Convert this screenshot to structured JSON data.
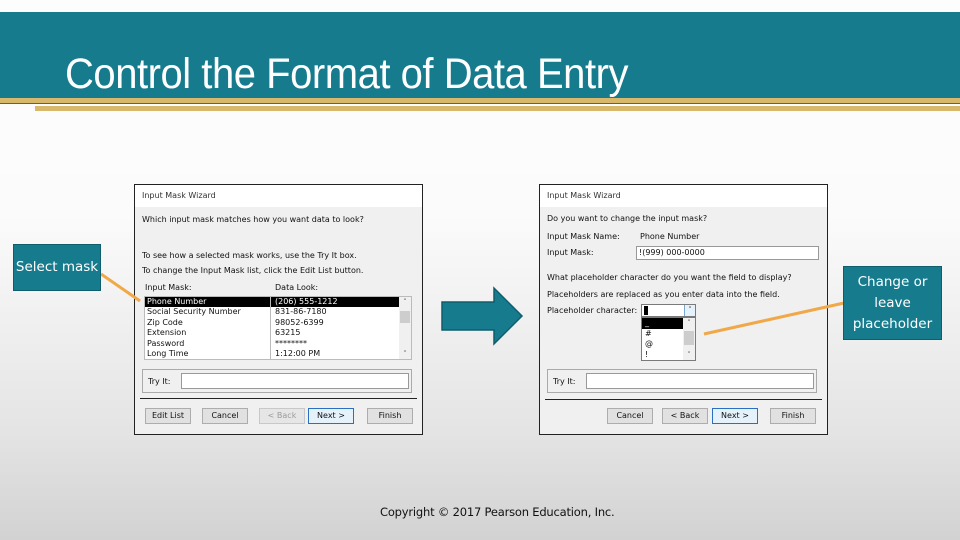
{
  "slide": {
    "title": "Control the Format of Data Entry",
    "footer": "Copyright © 2017 Pearson Education, Inc.",
    "colors": {
      "header": "#177b8e",
      "accent_bar": "#d8b96c",
      "connector": "#f0a848"
    }
  },
  "callouts": {
    "left": "Select mask",
    "right": "Change or leave placeholder"
  },
  "arrow_icon": "right-arrow",
  "wizard1": {
    "title": "Input Mask Wizard",
    "question": "Which input mask matches how you want data to look?",
    "hint1": "To see how a selected mask works, use the Try It box.",
    "hint2": "To change the Input Mask list, click the Edit List button.",
    "col_mask": "Input Mask:",
    "col_look": "Data Look:",
    "rows": [
      {
        "mask": "Phone Number",
        "look": "(206) 555-1212",
        "selected": true
      },
      {
        "mask": "Social Security Number",
        "look": "831-86-7180"
      },
      {
        "mask": "Zip Code",
        "look": "98052-6399"
      },
      {
        "mask": "Extension",
        "look": "63215"
      },
      {
        "mask": "Password",
        "look": "********"
      },
      {
        "mask": "Long Time",
        "look": "1:12:00 PM"
      }
    ],
    "try_it_label": "Try It:",
    "try_it_value": "",
    "buttons": {
      "edit_list": "Edit List",
      "cancel": "Cancel",
      "back": "< Back",
      "next": "Next >",
      "finish": "Finish"
    }
  },
  "wizard2": {
    "title": "Input Mask Wizard",
    "question": "Do you want to change the input mask?",
    "name_label": "Input Mask Name:",
    "name_value": "Phone Number",
    "mask_label": "Input Mask:",
    "mask_value": "!(999) 000-0000",
    "placeholder_question": "What placeholder character do you want the field to display?",
    "placeholder_hint": "Placeholders are replaced as you enter data into the field.",
    "placeholder_label": "Placeholder character:",
    "placeholder_value": "_",
    "placeholder_options": [
      "_",
      "#",
      "@",
      "!"
    ],
    "try_it_label": "Try It:",
    "try_it_value": "",
    "buttons": {
      "cancel": "Cancel",
      "back": "< Back",
      "next": "Next >",
      "finish": "Finish"
    }
  }
}
